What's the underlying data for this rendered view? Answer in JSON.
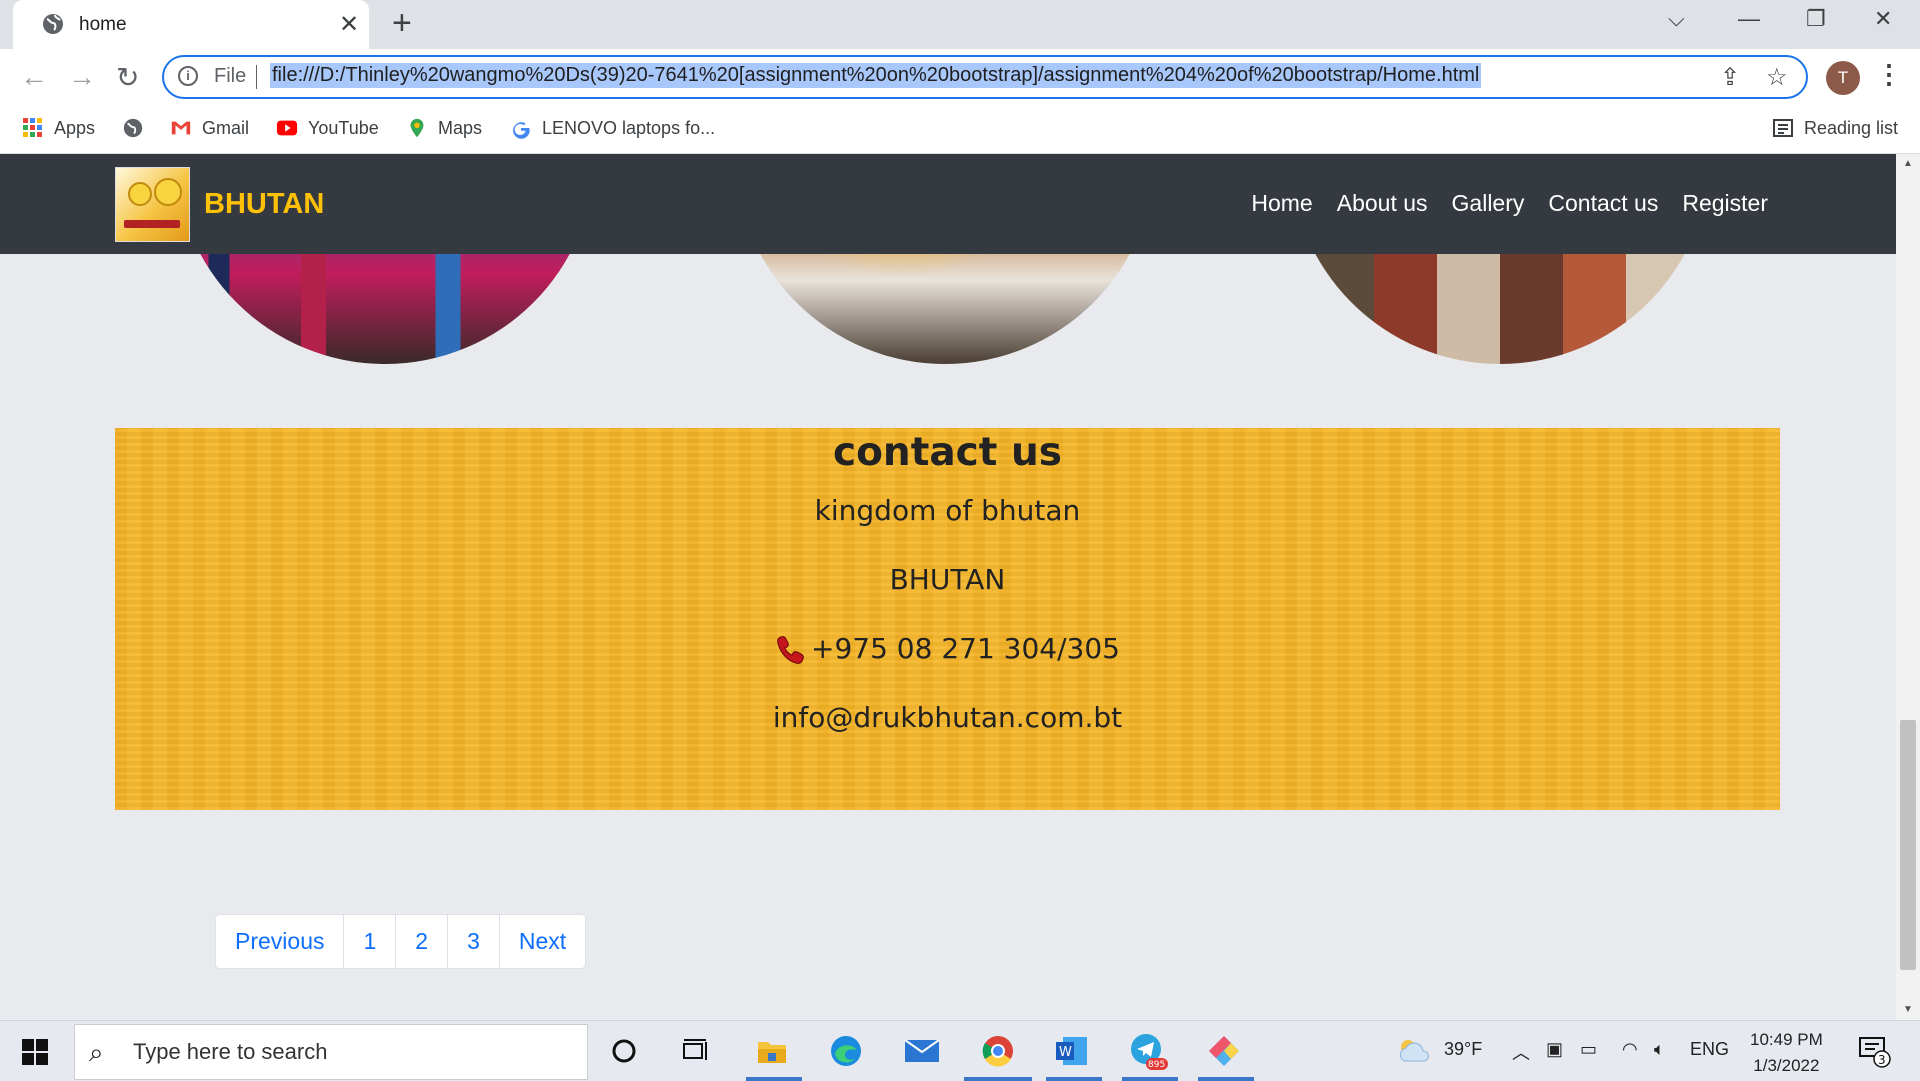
{
  "browser": {
    "tab_title": "home",
    "url_scheme_label": "File",
    "url": "file:///D:/Thinley%20wangmo%20Ds(39)20-7641%20[assignment%20on%20bootstrap]/assignment%204%20of%20bootstrap/Home.html",
    "profile_initial": "T",
    "bookmarks": [
      {
        "label": "Apps",
        "icon": "apps-grid-icon"
      },
      {
        "label": "",
        "icon": "globe-icon"
      },
      {
        "label": "Gmail",
        "icon": "gmail-icon"
      },
      {
        "label": "YouTube",
        "icon": "youtube-icon"
      },
      {
        "label": "Maps",
        "icon": "maps-icon"
      },
      {
        "label": "LENOVO laptops fo...",
        "icon": "google-icon"
      }
    ],
    "reading_list_label": "Reading list"
  },
  "site": {
    "brand": "BHUTAN",
    "nav": [
      "Home",
      "About us",
      "Gallery",
      "Contact us",
      "Register"
    ],
    "contact": {
      "heading": "contact us",
      "line1": "kingdom of bhutan",
      "line2": "BHUTAN",
      "phone": "+975 08 271 304/305",
      "email": "info@drukbhutan.com.bt"
    },
    "pagination": [
      "Previous",
      "1",
      "2",
      "3",
      "Next"
    ]
  },
  "taskbar": {
    "search_placeholder": "Type here to search",
    "weather": "39°F",
    "language": "ENG",
    "time": "10:49 PM",
    "date": "1/3/2022",
    "telegram_badge": "895",
    "notification_count": "3"
  },
  "colors": {
    "navbar_bg": "#343a40",
    "brand": "#ffc107",
    "contact_bg": "#f4b52a",
    "link": "#0d6efd"
  }
}
